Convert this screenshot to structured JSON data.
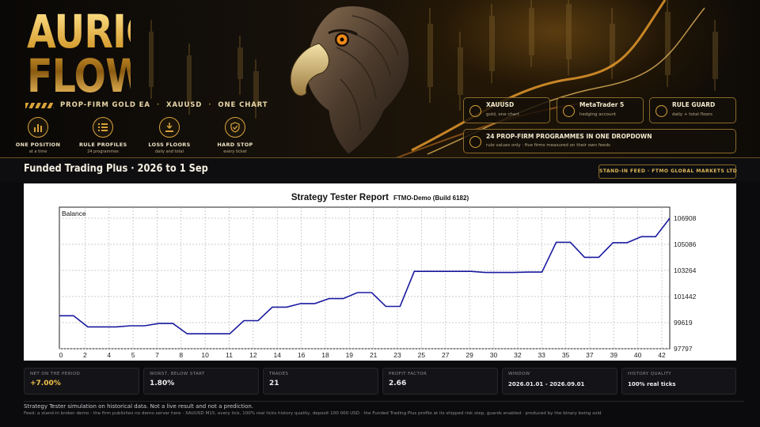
{
  "brand": {
    "logo_line1": "AURIC",
    "logo_line2": "FLOW",
    "tagline_1": "PROP-FIRM GOLD EA",
    "tagline_sep": "·",
    "tagline_2": "XAUUSD",
    "tagline_3": "ONE CHART"
  },
  "features": [
    {
      "title": "ONE POSITION",
      "sub": "at a time",
      "icon": "bar-chart-icon"
    },
    {
      "title": "RULE PROFILES",
      "sub": "24 programmes",
      "icon": "list-icon"
    },
    {
      "title": "LOSS FLOORS",
      "sub": "daily and total",
      "icon": "floor-icon"
    },
    {
      "title": "HARD STOP",
      "sub": "every ticket",
      "icon": "shield-check-icon"
    }
  ],
  "info_chips": [
    {
      "title": "XAUUSD",
      "sub": "gold, one chart",
      "icon": "gold-icon"
    },
    {
      "title": "MetaTrader 5",
      "sub": "hedging account",
      "icon": "terminal-icon"
    },
    {
      "title": "RULE GUARD",
      "sub": "daily + total floors",
      "icon": "shield-icon"
    },
    {
      "title": "24 PROP-FIRM PROGRAMMES IN ONE DROPDOWN",
      "sub": "rule values only  ·  five firms measured on their own feeds",
      "icon": "dropdown-icon"
    }
  ],
  "header": {
    "title": "Funded Trading Plus   ·   2026 to 1 Sep",
    "badge": "STAND-IN FEED  ·  FTMO GLOBAL MARKETS LTD"
  },
  "report": {
    "title": "Strategy Tester Report",
    "subtitle": "FTMO-Demo (Build 6182)"
  },
  "chart_data": {
    "type": "line",
    "series": [
      {
        "name": "Balance",
        "color": "#1a1aa0"
      }
    ],
    "x_ticks": [
      "0",
      "2",
      "4",
      "5",
      "7",
      "8",
      "10",
      "11",
      "12",
      "14",
      "16",
      "18",
      "19",
      "21",
      "23",
      "25",
      "27",
      "29",
      "30",
      "32",
      "33",
      "35",
      "37",
      "39",
      "40",
      "42"
    ],
    "y_ticks": [
      "106908",
      "105086",
      "103264",
      "101442",
      "99619",
      "97797"
    ],
    "ylim": [
      97797,
      106908
    ],
    "points": [
      [
        0,
        100100
      ],
      [
        1,
        100100
      ],
      [
        2,
        99320
      ],
      [
        3,
        99320
      ],
      [
        4,
        99320
      ],
      [
        5,
        99400
      ],
      [
        6,
        99400
      ],
      [
        7,
        99560
      ],
      [
        8,
        99560
      ],
      [
        9,
        98840
      ],
      [
        10,
        98840
      ],
      [
        11,
        98840
      ],
      [
        12,
        98840
      ],
      [
        13,
        99760
      ],
      [
        14,
        99760
      ],
      [
        15,
        100700
      ],
      [
        16,
        100700
      ],
      [
        17,
        100950
      ],
      [
        18,
        100950
      ],
      [
        19,
        101300
      ],
      [
        20,
        101300
      ],
      [
        21,
        101720
      ],
      [
        22,
        101720
      ],
      [
        23,
        100750
      ],
      [
        24,
        100750
      ],
      [
        25,
        103200
      ],
      [
        26,
        103200
      ],
      [
        27,
        103200
      ],
      [
        28,
        103200
      ],
      [
        29,
        103200
      ],
      [
        30,
        103120
      ],
      [
        31,
        103120
      ],
      [
        32,
        103120
      ],
      [
        33,
        103150
      ],
      [
        34,
        103150
      ],
      [
        35,
        105230
      ],
      [
        36,
        105230
      ],
      [
        37,
        104180
      ],
      [
        38,
        104180
      ],
      [
        39,
        105200
      ],
      [
        40,
        105200
      ],
      [
        41,
        105620
      ],
      [
        42,
        105620
      ],
      [
        43,
        106908
      ]
    ],
    "grid": true
  },
  "stats": [
    {
      "label": "NET ON THE PERIOD",
      "value": "+7.00%"
    },
    {
      "label": "WORST, BELOW START",
      "value": "1.80%"
    },
    {
      "label": "TRADES",
      "value": "21"
    },
    {
      "label": "PROFIT FACTOR",
      "value": "2.66"
    },
    {
      "label": "WINDOW",
      "value": "2026.01.01 - 2026.09.01"
    },
    {
      "label": "HISTORY QUALITY",
      "value": "100% real ticks"
    }
  ],
  "footer": {
    "line1": "Strategy Tester simulation on historical data. Not a live result and not a prediction.",
    "line2": "Feed: a stand-in broker demo - the firm publishes no demo server here  ·  XAUUSD M15, every tick, 100% real ticks history quality, deposit 100 000 USD  ·  the Funded Trading Plus profile at its shipped risk step, guards enabled  ·  produced by the binary being sold"
  },
  "colors": {
    "gold": "#d9a33a",
    "line": "#1a1aa0"
  }
}
